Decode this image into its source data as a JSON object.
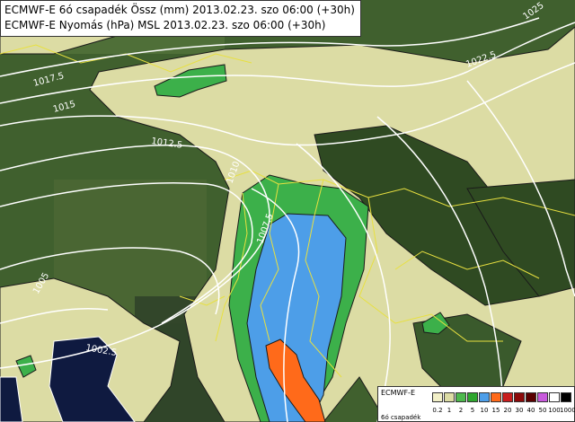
{
  "title_lines": [
    "ECMWF-E 6ó csapadék Össz (mm) 2013.02.23. szo 06:00 (+30h)",
    "ECMWF-E Nyomás (hPa) MSL 2013.02.23. szo 06:00 (+30h)"
  ],
  "isobar_labels": [
    "1025",
    "1022.5",
    "1017.5",
    "1015",
    "1012.5",
    "1010",
    "1007.5",
    "1005",
    "1002.5"
  ],
  "legend": {
    "title": "ECMWF-E",
    "subtitle": "6ó csapadék",
    "ticks": [
      "0.2",
      "1",
      "2",
      "5",
      "10",
      "15",
      "20",
      "30",
      "40",
      "50",
      "100",
      "1000"
    ],
    "colors": [
      "#f2f0c8",
      "#dcdca4",
      "#4db84d",
      "#2ea62e",
      "#4d9ee8",
      "#ff6a1a",
      "#c81e1e",
      "#8c0a0a",
      "#5a0000",
      "#c85adc",
      "#ffffff",
      "#000000"
    ]
  },
  "colors": {
    "precip_light": "#dcdca4",
    "precip_green": "#3cb04a",
    "precip_blue": "#4d9ee8",
    "precip_orange": "#ff6a1a",
    "precip_dark": "#0f1a40",
    "isobar": "#ffffff",
    "border": "#e8e040"
  }
}
